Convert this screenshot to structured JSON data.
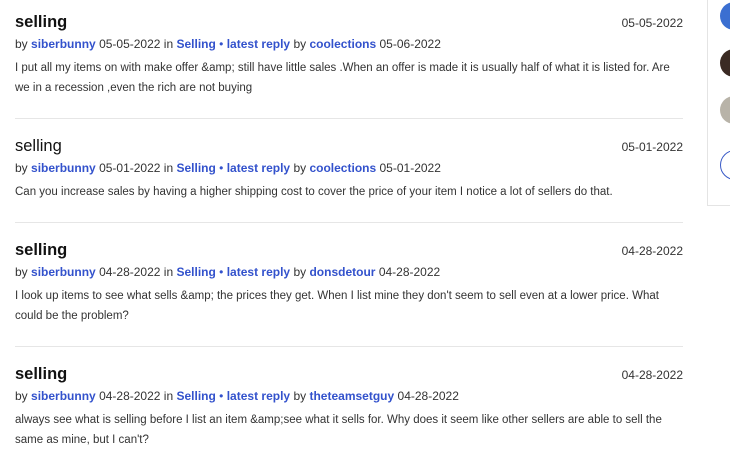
{
  "posts": [
    {
      "title": "selling",
      "date": "05-05-2022",
      "author": "siberbunny",
      "author_date": "05-05-2022",
      "in_label": "in",
      "board": "Selling",
      "sep": "•",
      "latest_label": "latest reply",
      "by_label": "by",
      "replier": "coolections",
      "reply_date": "05-06-2022",
      "body": "I put all my items on with make offer &amp; still have little sales .When an offer is made it is usually half of what it is listed for. Are we in a recession ,even the rich are not buying"
    },
    {
      "title": "selling",
      "date": "05-01-2022",
      "author": "siberbunny",
      "author_date": "05-01-2022",
      "in_label": "in",
      "board": "Selling",
      "sep": "•",
      "latest_label": "latest reply",
      "by_label": "by",
      "replier": "coolections",
      "reply_date": "05-01-2022",
      "body": "Can you increase sales by having a higher shipping cost to cover the price of your item I notice a lot of sellers do that."
    },
    {
      "title": "selling",
      "date": "04-28-2022",
      "author": "siberbunny",
      "author_date": "04-28-2022",
      "in_label": "in",
      "board": "Selling",
      "sep": "•",
      "latest_label": "latest reply",
      "by_label": "by",
      "replier": "donsdetour",
      "reply_date": "04-28-2022",
      "body": "I look up items to see what sells &amp; the prices they get. When I list mine they don't seem to sell even at a lower price. What could be the problem?"
    },
    {
      "title": "selling",
      "date": "04-28-2022",
      "author": "siberbunny",
      "author_date": "04-28-2022",
      "in_label": "in",
      "board": "Selling",
      "sep": "•",
      "latest_label": "latest reply",
      "by_label": "by",
      "replier": "theteamsetguy",
      "reply_date": "04-28-2022",
      "body": "always see what is selling before I list an item &amp;see what it sells for. Why does it seem like other sellers are able to sell the same as mine, but I can't?"
    }
  ],
  "labels": {
    "by": "by"
  }
}
